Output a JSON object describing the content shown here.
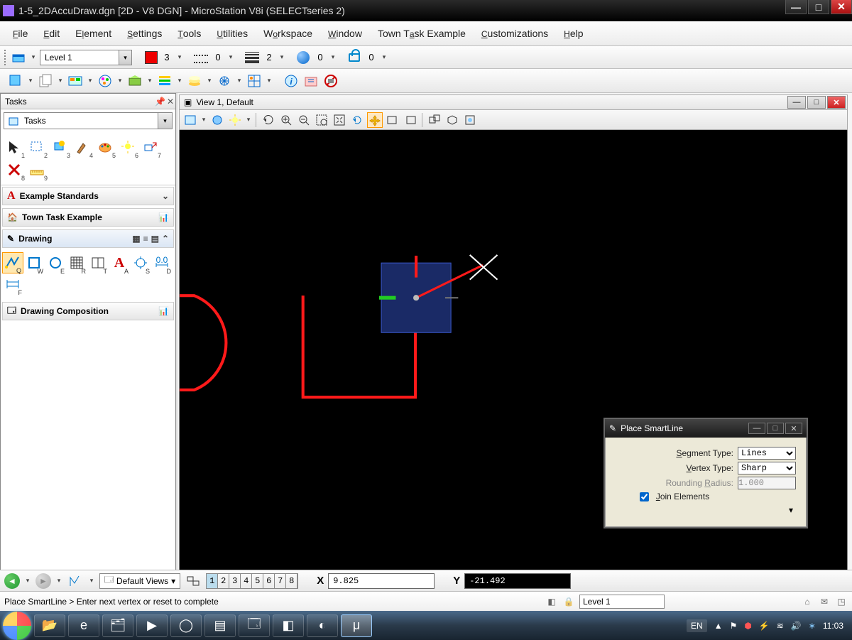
{
  "window": {
    "title": "1-5_2DAccuDraw.dgn [2D - V8 DGN] - MicroStation V8i (SELECTseries 2)"
  },
  "menu": [
    "File",
    "Edit",
    "Element",
    "Settings",
    "Tools",
    "Utilities",
    "Workspace",
    "Window",
    "Town Task Example",
    "Customizations",
    "Help"
  ],
  "attr": {
    "level": "Level 1",
    "color_num": "3",
    "style_num": "0",
    "weight_num": "2",
    "class_num": "0",
    "lock_num": "0"
  },
  "tasks": {
    "header": "Tasks",
    "combo": "Tasks",
    "sections": {
      "example": "Example Standards",
      "town": "Town Task Example",
      "drawing": "Drawing",
      "comp": "Drawing Composition"
    }
  },
  "view": {
    "title": "View 1, Default"
  },
  "dialog": {
    "title": "Place SmartLine",
    "segment_label": "Segment Type:",
    "segment_value": "Lines",
    "vertex_label": "Vertex Type:",
    "vertex_value": "Sharp",
    "radius_label": "Rounding Radius:",
    "radius_value": "1.000",
    "join_label": "Join Elements"
  },
  "views_row": {
    "default_views": "Default Views",
    "nums": [
      "1",
      "2",
      "3",
      "4",
      "5",
      "6",
      "7",
      "8"
    ],
    "X_label": "X",
    "X_value": "9.825",
    "Y_label": "Y",
    "Y_value": "-21.492"
  },
  "status": {
    "prompt": "Place SmartLine > Enter next vertex or reset to complete",
    "level": "Level 1"
  },
  "taskbar": {
    "lang": "EN",
    "clock": "11:03"
  }
}
